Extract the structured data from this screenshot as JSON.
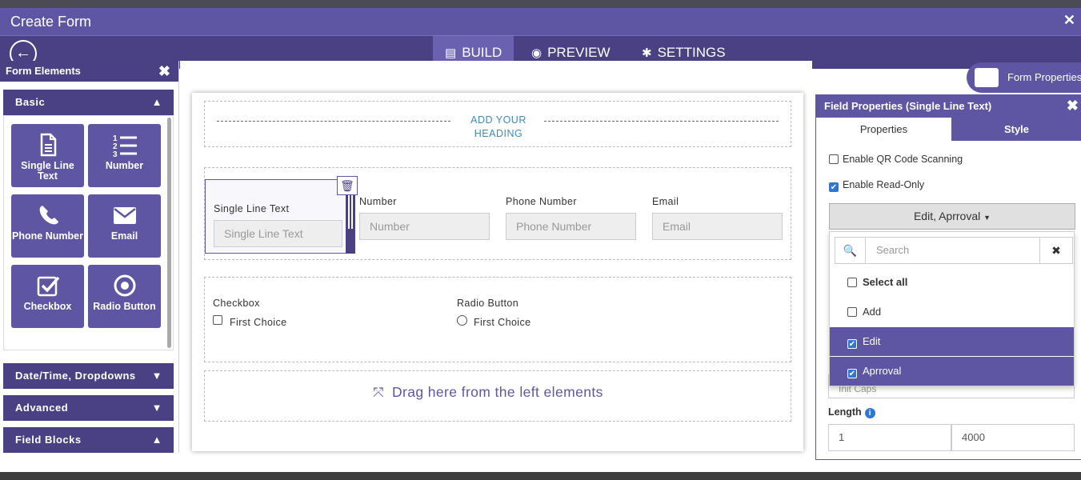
{
  "colors": {
    "primary": "#5f56a3",
    "primary_dark": "#4a4185",
    "checkbox_blue": "#2f77d4"
  },
  "window": {
    "title": "Create Form",
    "close_icon": "close-icon"
  },
  "nav": {
    "tabs": [
      {
        "label": "BUILD",
        "icon": "form-icon",
        "active": true
      },
      {
        "label": "PREVIEW",
        "icon": "eye-icon",
        "active": false
      },
      {
        "label": "SETTINGS",
        "icon": "gear-icon",
        "active": false
      }
    ]
  },
  "sidebar": {
    "title": "Form Elements",
    "sections": {
      "basic": "Basic",
      "datetime": "Date/Time, Dropdowns",
      "advanced": "Advanced",
      "field_blocks": "Field Blocks"
    },
    "tiles": [
      {
        "label": "Single Line Text",
        "icon": "document-icon"
      },
      {
        "label": "Number",
        "icon": "numbered-list-icon"
      },
      {
        "label": "Phone Number",
        "icon": "phone-icon"
      },
      {
        "label": "Email",
        "icon": "envelope-icon"
      },
      {
        "label": "Checkbox",
        "icon": "checkbox-icon"
      },
      {
        "label": "Radio Button",
        "icon": "radio-icon"
      }
    ]
  },
  "form_properties_button": {
    "label": "Form Properties"
  },
  "canvas": {
    "heading_placeholder": "ADD YOUR HEADING",
    "fields": [
      {
        "label": "Single Line Text",
        "placeholder": "Single Line Text"
      },
      {
        "label": "Number",
        "placeholder": "Number"
      },
      {
        "label": "Phone Number",
        "placeholder": "Phone Number"
      },
      {
        "label": "Email",
        "placeholder": "Email"
      }
    ],
    "checkbox": {
      "label": "Checkbox",
      "choice": "First Choice"
    },
    "radio": {
      "label": "Radio Button",
      "choice": "First Choice"
    },
    "drag_hint": "Drag here from the left elements"
  },
  "field_properties": {
    "title": "Field Properties (Single Line Text)",
    "tabs": [
      "Properties",
      "Style"
    ],
    "enable_qr": {
      "label": "Enable QR Code Scanning",
      "checked": false
    },
    "enable_readonly": {
      "label": "Enable Read-Only",
      "checked": true
    },
    "multiselect": {
      "value": "Edit, Aprroval",
      "search_placeholder": "Search",
      "options": [
        {
          "label": "Select all",
          "checked": false,
          "bold": true
        },
        {
          "label": "Add",
          "checked": false
        },
        {
          "label": "Edit",
          "checked": true
        },
        {
          "label": "Aprroval",
          "checked": true
        }
      ]
    },
    "hidden_input_fragment": "Init Caps",
    "length": {
      "label": "Length",
      "min": "1",
      "max": "4000"
    }
  }
}
